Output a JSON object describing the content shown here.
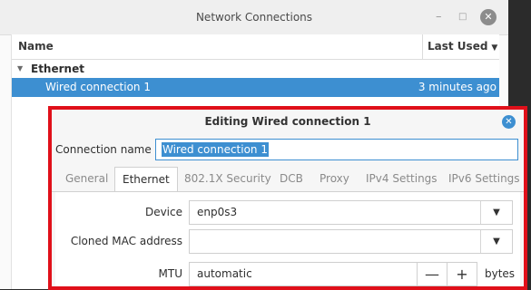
{
  "window": {
    "title": "Network Connections",
    "minimize_glyph": "–",
    "maximize_glyph": "□",
    "close_glyph": "✕"
  },
  "list": {
    "col_name": "Name",
    "col_last_used": "Last Used",
    "sort_arrow": "▼",
    "group_toggle": "▼",
    "group": "Ethernet",
    "connection": "Wired connection 1",
    "last_used": "3 minutes ago"
  },
  "dialog": {
    "title": "Editing Wired connection 1",
    "close_glyph": "✕",
    "connection_name_label": "Connection name",
    "connection_name_value": "Wired connection 1",
    "tabs": [
      "General",
      "Ethernet",
      "802.1X Security",
      "DCB",
      "Proxy",
      "IPv4 Settings",
      "IPv6 Settings"
    ],
    "active_tab": "Ethernet",
    "fields": {
      "device_label": "Device",
      "device_value": "enp0s3",
      "cloned_mac_label": "Cloned MAC address",
      "cloned_mac_value": "",
      "mtu_label": "MTU",
      "mtu_value": "automatic",
      "mtu_minus": "—",
      "mtu_plus": "+",
      "mtu_unit": "bytes",
      "dropdown_glyph": "▼"
    }
  },
  "colors": {
    "accent": "#3d8fd1",
    "highlight_border": "#e0101a"
  }
}
